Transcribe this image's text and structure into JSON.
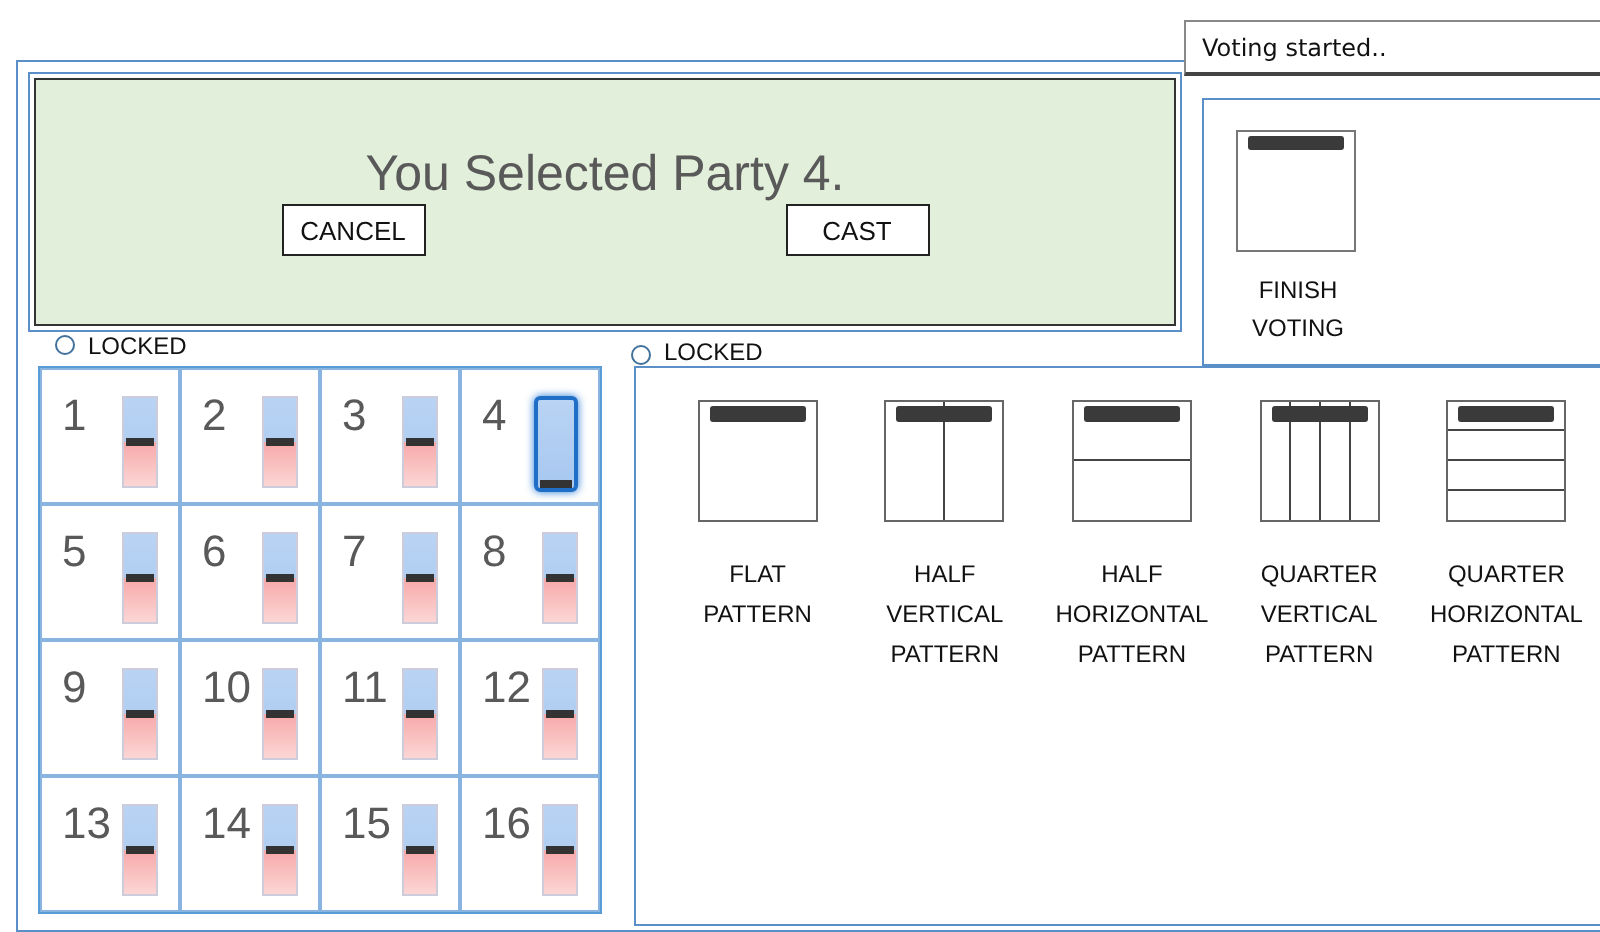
{
  "status": {
    "text": "Voting started.."
  },
  "display": {
    "message": "You Selected Party 4.",
    "buttons": [
      "CANCEL",
      "CAST"
    ]
  },
  "finish": {
    "label": "FINISH\nVOTING"
  },
  "party_panel": {
    "lock_label": "LOCKED",
    "parties": [
      {
        "number": "1",
        "level": 0.5,
        "selected": false
      },
      {
        "number": "2",
        "level": 0.5,
        "selected": false
      },
      {
        "number": "3",
        "level": 0.5,
        "selected": false
      },
      {
        "number": "4",
        "level": 0.05,
        "selected": true
      },
      {
        "number": "5",
        "level": 0.5,
        "selected": false
      },
      {
        "number": "6",
        "level": 0.5,
        "selected": false
      },
      {
        "number": "7",
        "level": 0.5,
        "selected": false
      },
      {
        "number": "8",
        "level": 0.5,
        "selected": false
      },
      {
        "number": "9",
        "level": 0.5,
        "selected": false
      },
      {
        "number": "10",
        "level": 0.5,
        "selected": false
      },
      {
        "number": "11",
        "level": 0.5,
        "selected": false
      },
      {
        "number": "12",
        "level": 0.5,
        "selected": false
      },
      {
        "number": "13",
        "level": 0.5,
        "selected": false
      },
      {
        "number": "14",
        "level": 0.5,
        "selected": false
      },
      {
        "number": "15",
        "level": 0.5,
        "selected": false
      },
      {
        "number": "16",
        "level": 0.5,
        "selected": false
      }
    ]
  },
  "pattern_panel": {
    "lock_label": "LOCKED",
    "patterns": [
      {
        "kind": "flat",
        "label": "FLAT\nPATTERN"
      },
      {
        "kind": "half_vertical",
        "label": "HALF\nVERTICAL\nPATTERN"
      },
      {
        "kind": "half_horizontal",
        "label": "HALF\nHORIZONTAL\nPATTERN"
      },
      {
        "kind": "quarter_vertical",
        "label": "QUARTER\nVERTICAL\nPATTERN"
      },
      {
        "kind": "quarter_horizontal",
        "label": "QUARTER\nHORIZONTAL\nPATTERN"
      }
    ]
  }
}
